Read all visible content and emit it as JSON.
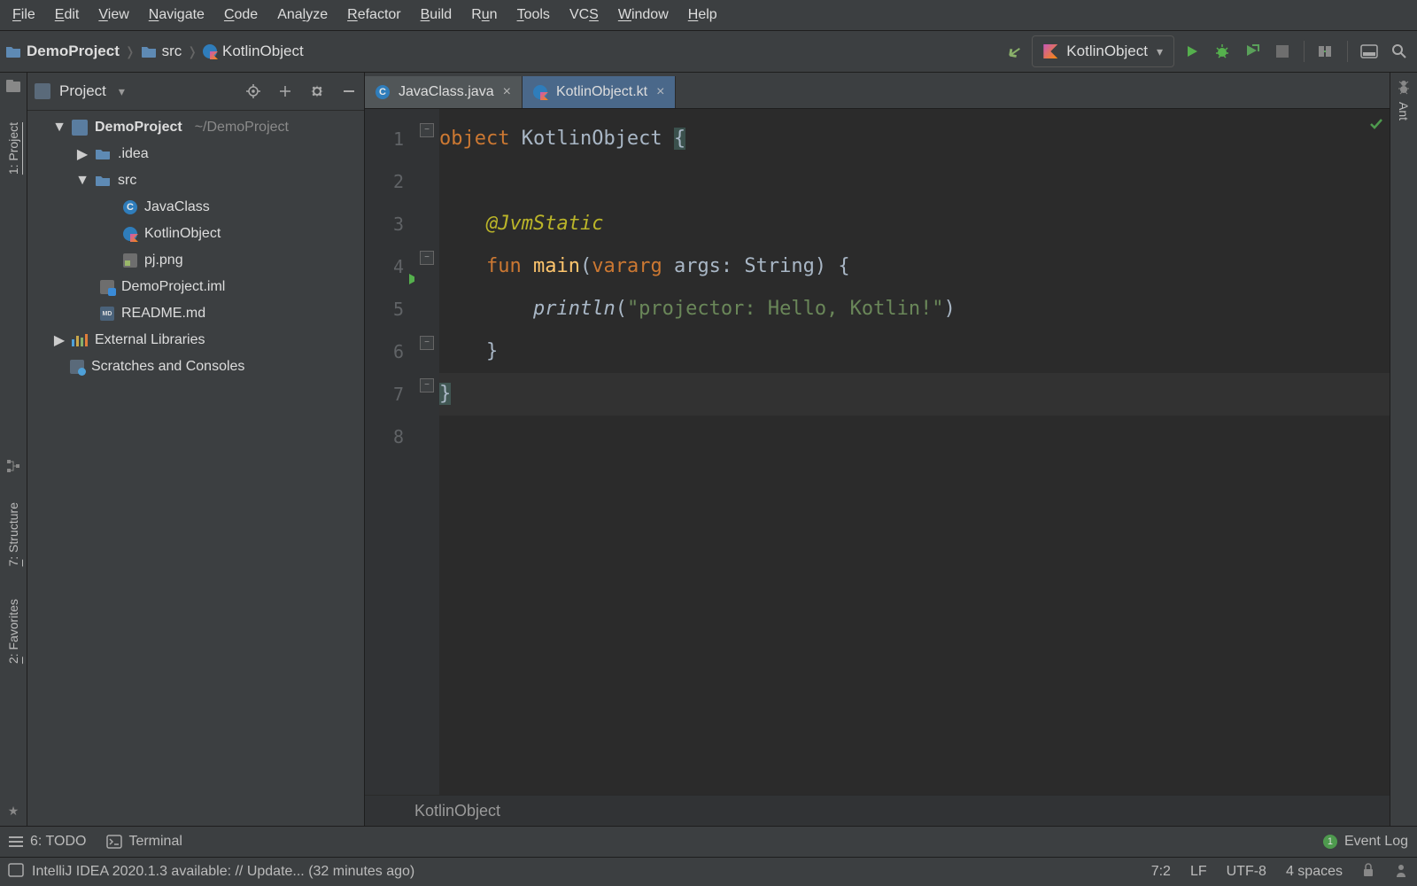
{
  "menus": [
    "File",
    "Edit",
    "View",
    "Navigate",
    "Code",
    "Analyze",
    "Refactor",
    "Build",
    "Run",
    "Tools",
    "VCS",
    "Window",
    "Help"
  ],
  "menu_accel": [
    0,
    0,
    0,
    0,
    0,
    3,
    0,
    0,
    1,
    0,
    2,
    0,
    0
  ],
  "breadcrumbs": {
    "project": "DemoProject",
    "src": "src",
    "file": "KotlinObject"
  },
  "run_config": {
    "label": "KotlinObject"
  },
  "tool_windows": {
    "left": [
      {
        "id": "project",
        "label": "1: Project"
      },
      {
        "id": "structure",
        "label": "7: Structure"
      },
      {
        "id": "favorites",
        "label": "2: Favorites"
      }
    ],
    "right": [
      {
        "id": "ant",
        "label": "Ant"
      }
    ]
  },
  "project_panel": {
    "title": "Project"
  },
  "tree": {
    "root": {
      "label": "DemoProject",
      "path": "~/DemoProject"
    },
    "idea": ".idea",
    "src": "src",
    "src_children": [
      {
        "kind": "java",
        "label": "JavaClass"
      },
      {
        "kind": "kt",
        "label": "KotlinObject"
      },
      {
        "kind": "png",
        "label": "pj.png"
      }
    ],
    "iml": "DemoProject.iml",
    "readme": "README.md",
    "extlib": "External Libraries",
    "scratch": "Scratches and Consoles"
  },
  "tabs": [
    {
      "label": "JavaClass.java",
      "kind": "java",
      "active": false
    },
    {
      "label": "KotlinObject.kt",
      "kind": "kt",
      "active": true
    }
  ],
  "editor": {
    "lines": 8,
    "run_line": 4,
    "breadcrumb": "KotlinObject",
    "tokens": {
      "l1_obj": "object",
      "l1_name": " KotlinObject ",
      "l1_brace": "{",
      "l3_anno": "@JvmStatic",
      "l4_fun": "fun",
      "l4_name": " main",
      "l4_open": "(",
      "l4_vararg": "vararg",
      "l4_args": " args: String) {",
      "l5_call": "println",
      "l5_open": "(",
      "l5_str": "\"projector: Hello, Kotlin!\"",
      "l5_close": ")",
      "l6_close": "}",
      "l7_close": "}"
    }
  },
  "bottom_tools": {
    "todo": "6: TODO",
    "terminal": "Terminal",
    "eventlog": "Event Log",
    "event_count": "1"
  },
  "status": {
    "message": "IntelliJ IDEA 2020.1.3 available: // Update... (32 minutes ago)",
    "pos": "7:2",
    "le": "LF",
    "enc": "UTF-8",
    "indent": "4 spaces"
  }
}
